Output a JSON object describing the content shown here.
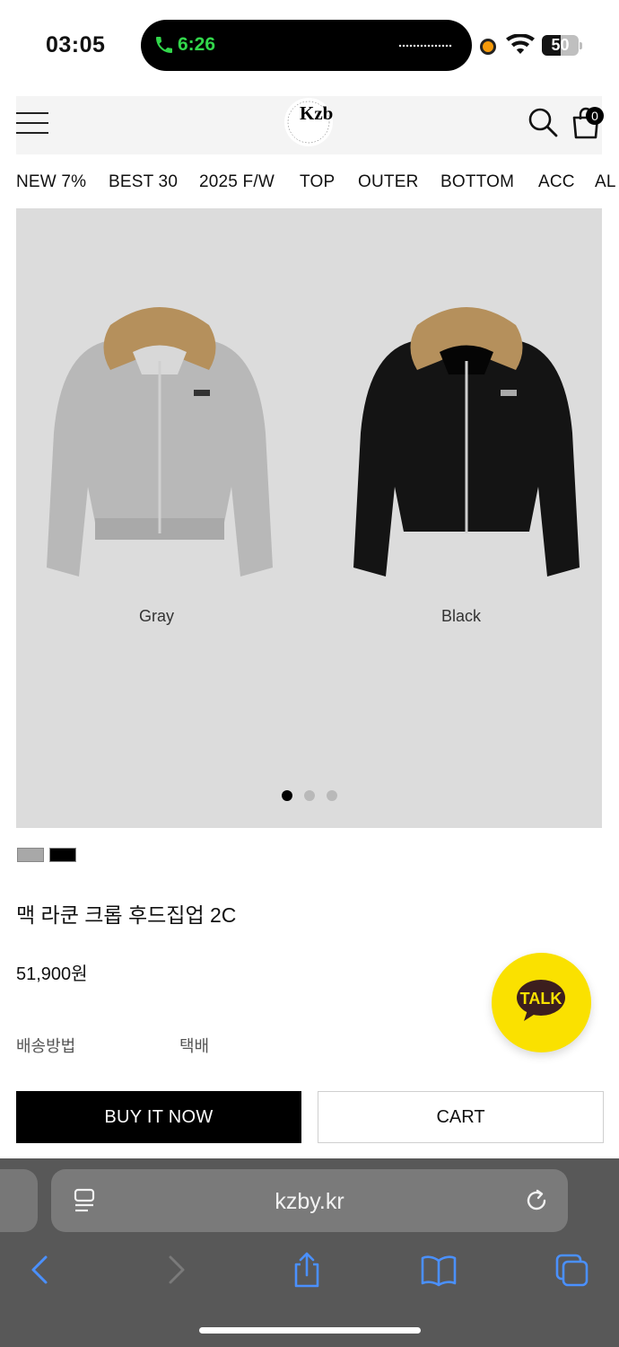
{
  "status_bar": {
    "time": "03:05",
    "call_duration": "6:26",
    "battery_level": "50",
    "battery_fraction": 0.5
  },
  "header": {
    "logo_text": "Kzb",
    "cart_count": "0"
  },
  "categories": [
    "NEW 7%",
    "BEST 30",
    "2025 F/W",
    "TOP",
    "OUTER",
    "BOTTOM",
    "ACC",
    "AL"
  ],
  "gallery": {
    "variants": [
      {
        "color_name": "Gray",
        "hex": "#b9b9b9"
      },
      {
        "color_name": "Black",
        "hex": "#141414"
      }
    ],
    "page_count": 3,
    "current_page": 1
  },
  "swatches": [
    {
      "name": "gray",
      "hex": "#a8a8a8"
    },
    {
      "name": "black",
      "hex": "#000000"
    }
  ],
  "product": {
    "title": "맥 라쿤 크롭 후드집업 2C",
    "price": "51,900원",
    "shipping_label": "배송방법",
    "shipping_value": "택배"
  },
  "chat": {
    "label": "TALK",
    "brand_color": "#fae100"
  },
  "actions": {
    "buy_now": "BUY IT NOW",
    "cart": "CART"
  },
  "browser": {
    "url": "kzby.kr",
    "accent": "#4a90ff"
  }
}
